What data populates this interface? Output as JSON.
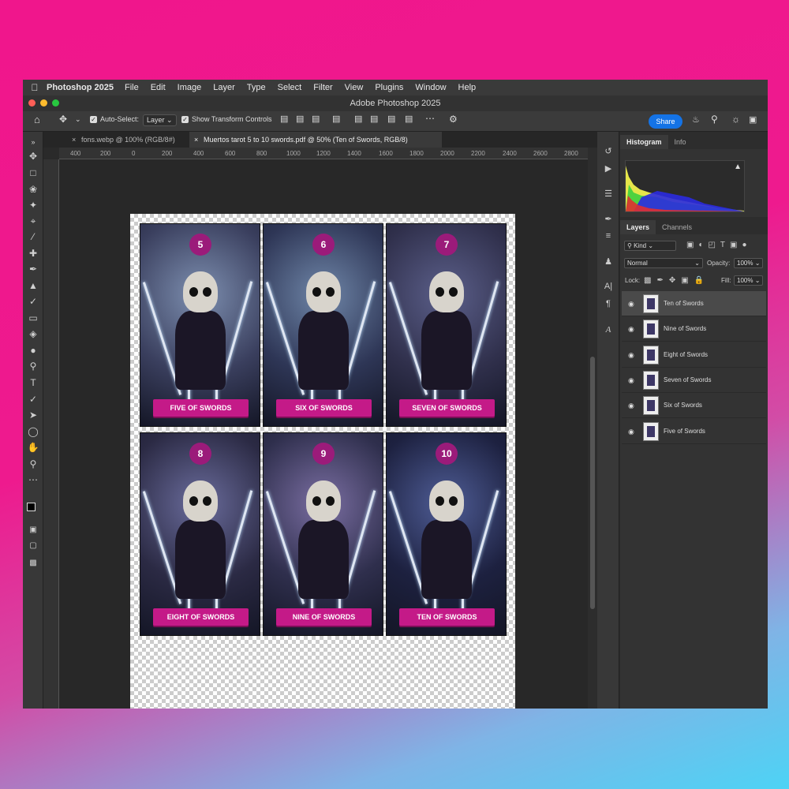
{
  "menubar": {
    "app_name": "Photoshop 2025",
    "items": [
      "File",
      "Edit",
      "Image",
      "Layer",
      "Type",
      "Select",
      "Filter",
      "View",
      "Plugins",
      "Window",
      "Help"
    ]
  },
  "window": {
    "title": "Adobe Photoshop 2025"
  },
  "options": {
    "auto_select_label": "Auto-Select:",
    "auto_select_value": "Layer",
    "transform_label": "Show Transform Controls",
    "share_label": "Share"
  },
  "tabs": [
    {
      "label": "fons.webp @ 100% (RGB/8#)",
      "active": false
    },
    {
      "label": "Muertos tarot 5 to 10 swords.pdf @ 50% (Ten of Swords, RGB/8)",
      "active": true
    }
  ],
  "ruler": {
    "top_ticks": [
      "400",
      "200",
      "0",
      "200",
      "400",
      "600",
      "800",
      "1000",
      "1200",
      "1400",
      "1600",
      "1800",
      "2000",
      "2200",
      "2400",
      "2600",
      "2800"
    ]
  },
  "cards": [
    {
      "number": "5",
      "label": "FIVE OF SWORDS",
      "bg": "#3a3f5e",
      "tone": "#7d8fb0"
    },
    {
      "number": "6",
      "label": "SIX OF SWORDS",
      "bg": "#2e3656",
      "tone": "#6f86a8"
    },
    {
      "number": "7",
      "label": "SEVEN OF SWORDS",
      "bg": "#30304c",
      "tone": "#5b5f8a"
    },
    {
      "number": "8",
      "label": "EIGHT OF SWORDS",
      "bg": "#2b2a44",
      "tone": "#6a6c9c"
    },
    {
      "number": "9",
      "label": "NINE OF SWORDS",
      "bg": "#2f2f4d",
      "tone": "#7a6ea2"
    },
    {
      "number": "10",
      "label": "TEN OF SWORDS",
      "bg": "#1d2140",
      "tone": "#4f5d96"
    }
  ],
  "panels": {
    "top_tabs": [
      "Histogram",
      "Info"
    ],
    "layer_tabs": [
      "Layers",
      "Channels"
    ],
    "kind_label": "Kind",
    "blend_mode": "Normal",
    "opacity_label": "Opacity:",
    "opacity_value": "100%",
    "lock_label": "Lock:",
    "fill_label": "Fill:",
    "fill_value": "100%"
  },
  "layers": [
    {
      "name": "Ten of Swords",
      "selected": true
    },
    {
      "name": "Nine of Swords",
      "selected": false
    },
    {
      "name": "Eight of Swords",
      "selected": false
    },
    {
      "name": "Seven of Swords",
      "selected": false
    },
    {
      "name": "Six of Swords",
      "selected": false
    },
    {
      "name": "Five of Swords",
      "selected": false
    }
  ],
  "colors": {
    "accent": "#1473e6",
    "card_badge": "#9b1b7a",
    "card_banner": "#c41a88"
  }
}
